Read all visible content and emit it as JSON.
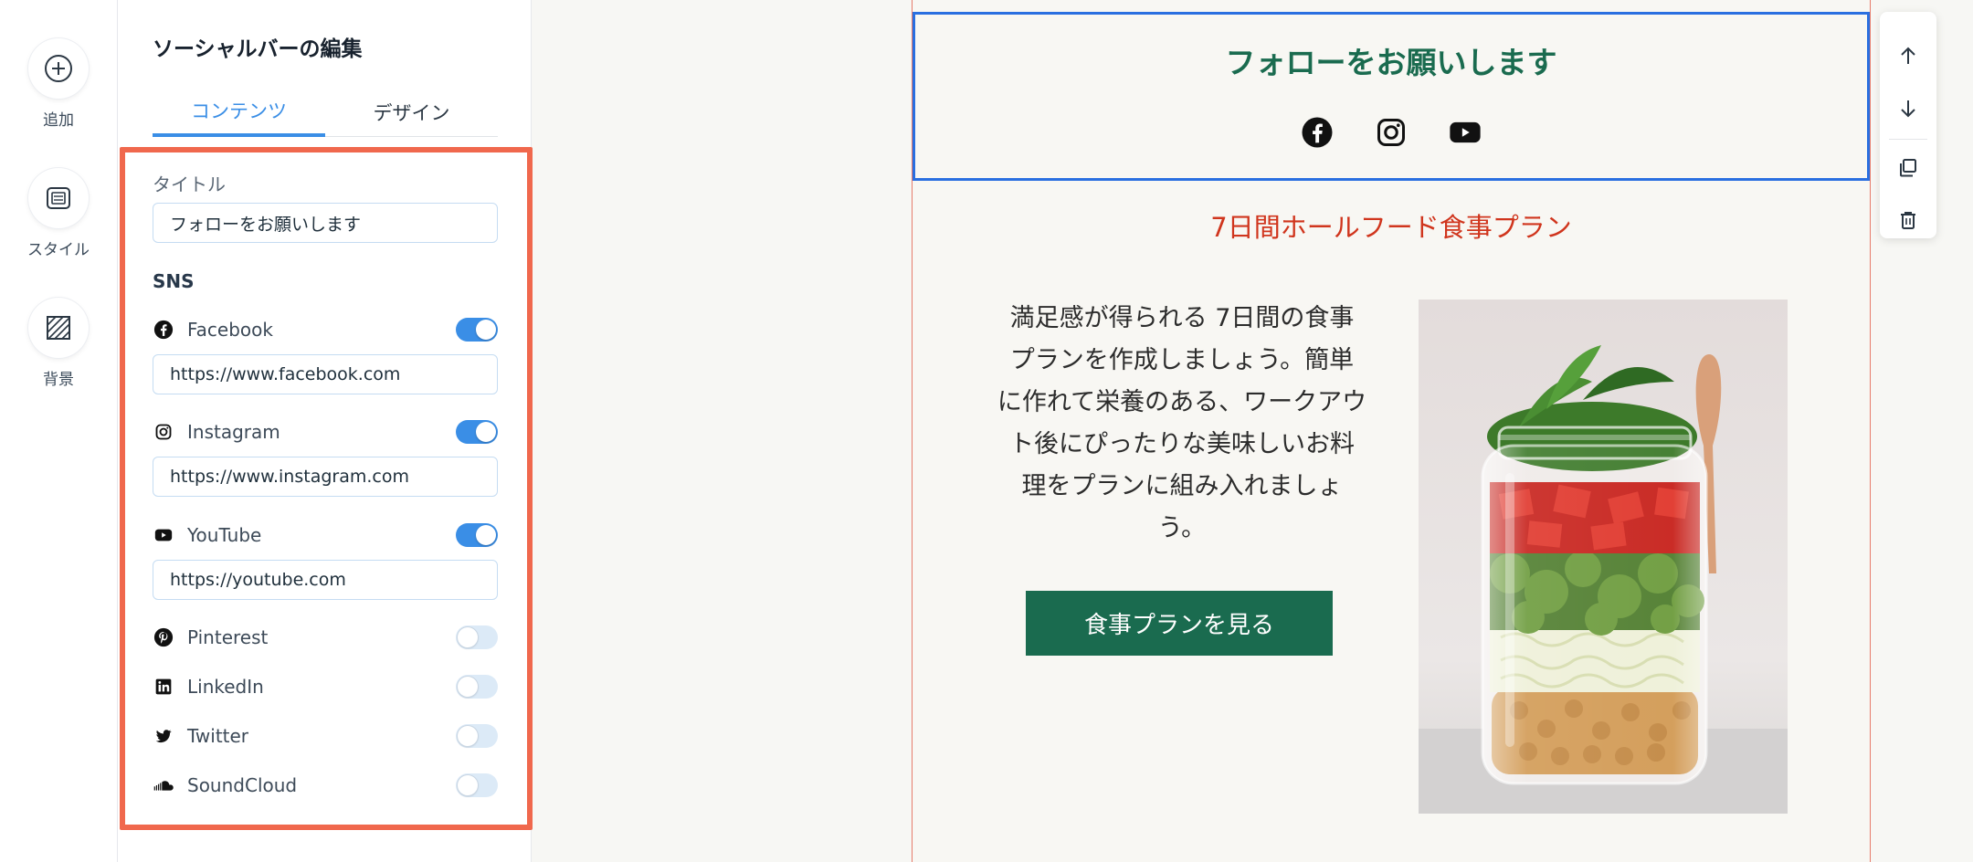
{
  "rail": {
    "items": [
      {
        "label": "追加",
        "icon": "plus-circle-icon"
      },
      {
        "label": "スタイル",
        "icon": "style-icon"
      },
      {
        "label": "背景",
        "icon": "background-icon"
      }
    ]
  },
  "panel": {
    "title": "ソーシャルバーの編集",
    "tabs": [
      {
        "label": "コンテンツ",
        "active": true
      },
      {
        "label": "デザイン",
        "active": false
      }
    ],
    "title_field": {
      "label": "タイトル",
      "value": "フォローをお願いします"
    },
    "sns_section_label": "SNS",
    "networks": [
      {
        "name": "Facebook",
        "enabled": true,
        "url": "https://www.facebook.com",
        "icon": "facebook-icon"
      },
      {
        "name": "Instagram",
        "enabled": true,
        "url": "https://www.instagram.com",
        "icon": "instagram-icon"
      },
      {
        "name": "YouTube",
        "enabled": true,
        "url": "https://youtube.com",
        "icon": "youtube-icon"
      },
      {
        "name": "Pinterest",
        "enabled": false,
        "icon": "pinterest-icon"
      },
      {
        "name": "LinkedIn",
        "enabled": false,
        "icon": "linkedin-icon"
      },
      {
        "name": "Twitter",
        "enabled": false,
        "icon": "twitter-icon"
      },
      {
        "name": "SoundCloud",
        "enabled": false,
        "icon": "soundcloud-icon"
      }
    ]
  },
  "email": {
    "social_title": "フォローをお願いします",
    "plan_title": "7日間ホールフード食事プラン",
    "plan_body": "満足感が得られる 7日間の食事\nプランを作成しましょう。簡単\nに作れて栄養のある、ワークアウ\nト後にぴったりな美味しいお料\n理をプランに組み入れましょ\nう。",
    "plan_button": "食事プランを見る"
  },
  "toolbar": {
    "buttons": [
      "move-up-icon",
      "move-down-icon",
      "duplicate-icon",
      "delete-icon"
    ]
  },
  "colors": {
    "accent_blue": "#3a8ee6",
    "highlight_frame": "#f0684d",
    "brand_green": "#1a6b4f",
    "plan_title_red": "#d0351d",
    "selection_blue": "#2a6fe0"
  }
}
